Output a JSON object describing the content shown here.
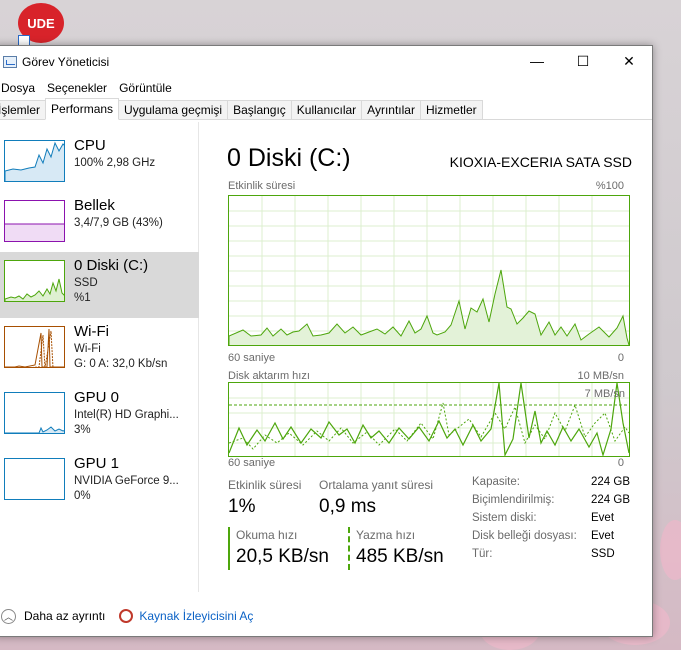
{
  "window": {
    "title": "Görev Yöneticisi",
    "minimize": "—",
    "maximize": "☐",
    "close": "✕"
  },
  "menu": [
    "Dosya",
    "Seçenekler",
    "Görüntüle"
  ],
  "tabs": [
    "İşlemler",
    "Performans",
    "Uygulama geçmişi",
    "Başlangıç",
    "Kullanıcılar",
    "Ayrıntılar",
    "Hizmetler"
  ],
  "desktop_icon": {
    "label": "UDE"
  },
  "sidebar": {
    "items": [
      {
        "title": "CPU",
        "line1": "100% 2,98 GHz",
        "line2": ""
      },
      {
        "title": "Bellek",
        "line1": "3,4/7,9 GB (43%)",
        "line2": ""
      },
      {
        "title": "0 Diski (C:)",
        "line1": "SSD",
        "line2": "%1"
      },
      {
        "title": "Wi-Fi",
        "line1": "Wi-Fi",
        "line2": "G: 0 A: 32,0 Kb/sn"
      },
      {
        "title": "GPU 0",
        "line1": "Intel(R) HD Graphi...",
        "line2": "3%"
      },
      {
        "title": "GPU 1",
        "line1": "NVIDIA GeForce 9...",
        "line2": "0%"
      }
    ]
  },
  "disk": {
    "title": "0 Diski (C:)",
    "model": "KIOXIA-EXCERIA SATA SSD",
    "activity_label": "Etkinlik süresi",
    "activity_max": "%100",
    "activity_x_left": "60 saniye",
    "activity_x_right": "0",
    "transfer_label": "Disk aktarım hızı",
    "transfer_max": "10 MB/sn",
    "transfer_mark": "7 MB/sn",
    "transfer_x_left": "60 saniye",
    "transfer_x_right": "0",
    "stats": {
      "active_label": "Etkinlik süresi",
      "active_value": "1%",
      "response_label": "Ortalama yanıt süresi",
      "response_value": "0,9 ms",
      "read_label": "Okuma hızı",
      "read_value": "20,5 KB/sn",
      "write_label": "Yazma hızı",
      "write_value": "485 KB/sn"
    },
    "props": [
      {
        "label": "Kapasite:",
        "value": "224 GB"
      },
      {
        "label": "Biçimlendirilmiş:",
        "value": "224 GB"
      },
      {
        "label": "Sistem diski:",
        "value": "Evet"
      },
      {
        "label": "Disk belleği dosyası:",
        "value": "Evet"
      },
      {
        "label": "Tür:",
        "value": "SSD"
      }
    ]
  },
  "footer": {
    "fewer_details": "Daha az ayrıntı",
    "resource_monitor": "Kaynak İzleyicisini Aç"
  },
  "colors": {
    "disk_green": "#4da60c",
    "cpu_blue": "#117dbb",
    "mem_purple": "#8b12ae",
    "wifi_orange": "#a74f01",
    "selected": "#d9d9d9"
  }
}
